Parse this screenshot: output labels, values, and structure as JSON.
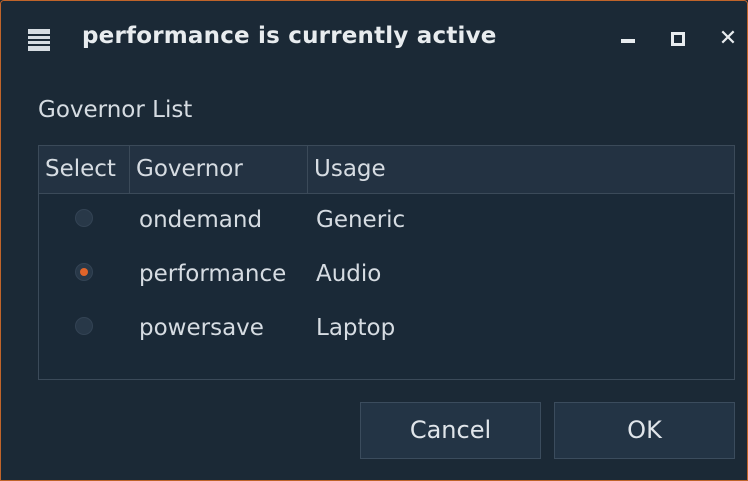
{
  "window": {
    "title": "performance is currently active",
    "icon": "table-icon",
    "controls": [
      "minimize-icon",
      "maximize-icon",
      "close-icon"
    ],
    "close_glyph": "✕"
  },
  "colors": {
    "background": "#1b2936",
    "accent": "#e0642a",
    "border": "#c0642a"
  },
  "group": {
    "label": "Governor List"
  },
  "table": {
    "headers": [
      "Select",
      "Governor",
      "Usage"
    ],
    "rows": [
      {
        "selected": false,
        "governor": "ondemand",
        "usage": "Generic"
      },
      {
        "selected": true,
        "governor": "performance",
        "usage": "Audio"
      },
      {
        "selected": false,
        "governor": "powersave",
        "usage": "Laptop"
      }
    ]
  },
  "buttons": {
    "cancel": "Cancel",
    "ok": "OK"
  }
}
